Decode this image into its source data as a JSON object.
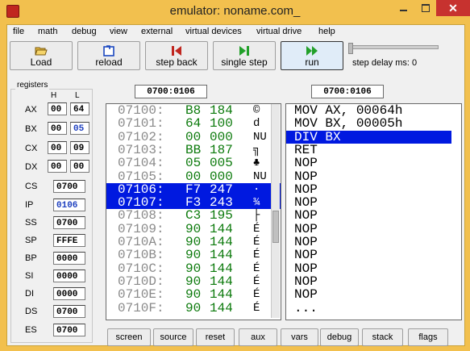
{
  "window": {
    "title": "emulator: noname.com_"
  },
  "menu": [
    "file",
    "math",
    "debug",
    "view",
    "external",
    "virtual devices",
    "virtual drive",
    "help"
  ],
  "toolbar": {
    "load": "Load",
    "reload": "reload",
    "step_back": "step back",
    "single_step": "single step",
    "run": "run",
    "step_delay": "step delay ms: 0",
    "step_delay_value": 0
  },
  "registers": {
    "title": "registers",
    "h_label": "H",
    "l_label": "L",
    "names": {
      "ax": "AX",
      "bx": "BX",
      "cx": "CX",
      "dx": "DX",
      "cs": "CS",
      "ip": "IP",
      "ss": "SS",
      "sp": "SP",
      "bp": "BP",
      "si": "SI",
      "di": "DI",
      "ds": "DS",
      "es": "ES"
    },
    "ax": {
      "h": "00",
      "l": "64"
    },
    "bx": {
      "h": "00",
      "l": "05"
    },
    "cx": {
      "h": "00",
      "l": "09"
    },
    "dx": {
      "h": "00",
      "l": "00"
    },
    "cs": "0700",
    "ip": "0106",
    "ss": "0700",
    "sp": "FFFE",
    "bp": "0000",
    "si": "0000",
    "di": "0000",
    "ds": "0700",
    "es": "0700"
  },
  "memory": {
    "address": "0700:0106",
    "rows": [
      {
        "addr": "07100:",
        "hex": "B8",
        "dec": "184",
        "chr": "©"
      },
      {
        "addr": "07101:",
        "hex": "64",
        "dec": "100",
        "chr": "d"
      },
      {
        "addr": "07102:",
        "hex": "00",
        "dec": "000",
        "chr": "NU"
      },
      {
        "addr": "07103:",
        "hex": "BB",
        "dec": "187",
        "chr": "╗"
      },
      {
        "addr": "07104:",
        "hex": "05",
        "dec": "005",
        "chr": "♣"
      },
      {
        "addr": "07105:",
        "hex": "00",
        "dec": "000",
        "chr": "NU"
      },
      {
        "addr": "07106:",
        "hex": "F7",
        "dec": "247",
        "chr": "·"
      },
      {
        "addr": "07107:",
        "hex": "F3",
        "dec": "243",
        "chr": "¾"
      },
      {
        "addr": "07108:",
        "hex": "C3",
        "dec": "195",
        "chr": "├"
      },
      {
        "addr": "07109:",
        "hex": "90",
        "dec": "144",
        "chr": "É"
      },
      {
        "addr": "0710A:",
        "hex": "90",
        "dec": "144",
        "chr": "É"
      },
      {
        "addr": "0710B:",
        "hex": "90",
        "dec": "144",
        "chr": "É"
      },
      {
        "addr": "0710C:",
        "hex": "90",
        "dec": "144",
        "chr": "É"
      },
      {
        "addr": "0710D:",
        "hex": "90",
        "dec": "144",
        "chr": "É"
      },
      {
        "addr": "0710E:",
        "hex": "90",
        "dec": "144",
        "chr": "É"
      },
      {
        "addr": "0710F:",
        "hex": "90",
        "dec": "144",
        "chr": "É"
      }
    ]
  },
  "disassembly": {
    "address": "0700:0106",
    "lines": [
      "MOV AX, 00064h",
      "MOV BX, 00005h",
      "DIV BX",
      "RET",
      "NOP",
      "NOP",
      "NOP",
      "NOP",
      "NOP",
      "NOP",
      "NOP",
      "NOP",
      "NOP",
      "NOP",
      "NOP",
      "..."
    ]
  },
  "bottom_buttons": [
    "screen",
    "source",
    "reset",
    "aux",
    "vars",
    "debug",
    "stack",
    "flags"
  ],
  "colors": {
    "selection": "#0019e0",
    "window_frame": "#f2c04e",
    "hex_green": "#0c7a0c",
    "addr_gray": "#8a8a8a"
  }
}
